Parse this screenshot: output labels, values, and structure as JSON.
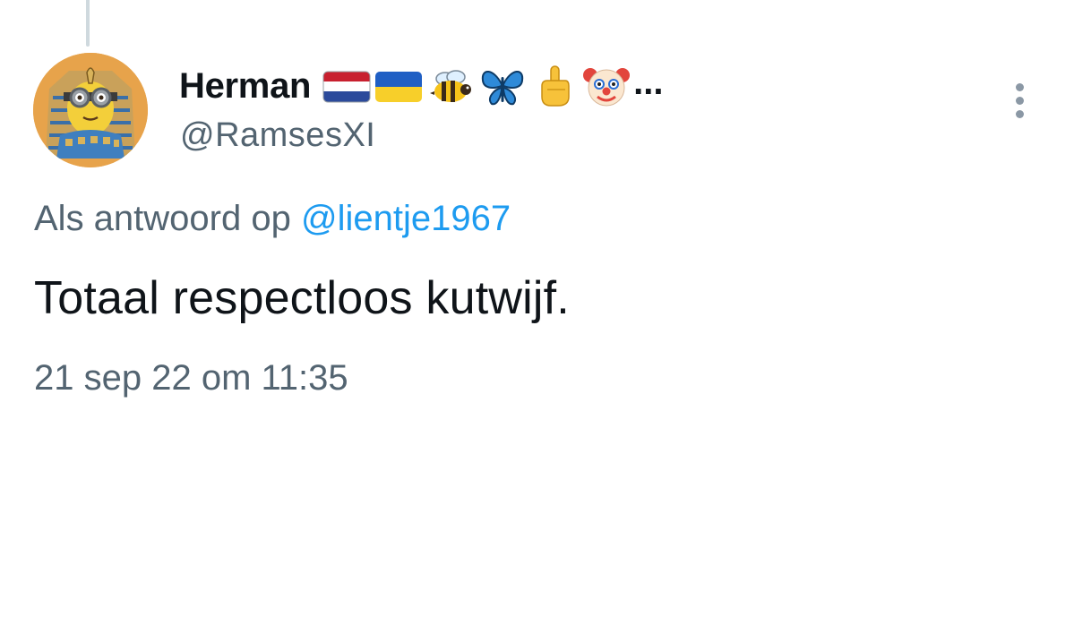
{
  "tweet": {
    "author": {
      "display_name": "Herman",
      "name_emojis": [
        "flag-netherlands-icon",
        "flag-ukraine-icon",
        "bee-icon",
        "butterfly-icon",
        "middle-finger-icon",
        "clown-face-icon"
      ],
      "name_truncation": "...",
      "handle": "@RamsesXI",
      "avatar": "pharaoh-minion-avatar"
    },
    "reply_to": {
      "prefix": "Als antwoord op",
      "mention": "@lientje1967"
    },
    "text": "Totaal respectloos kutwijf.",
    "timestamp": "21 sep 22 om 11:35",
    "more_icon": "more-options-vertical-icon"
  },
  "colors": {
    "primary_text": "#0f1419",
    "secondary_text": "#536471",
    "link": "#1d9bf0",
    "thread_line": "#cfd9de"
  }
}
